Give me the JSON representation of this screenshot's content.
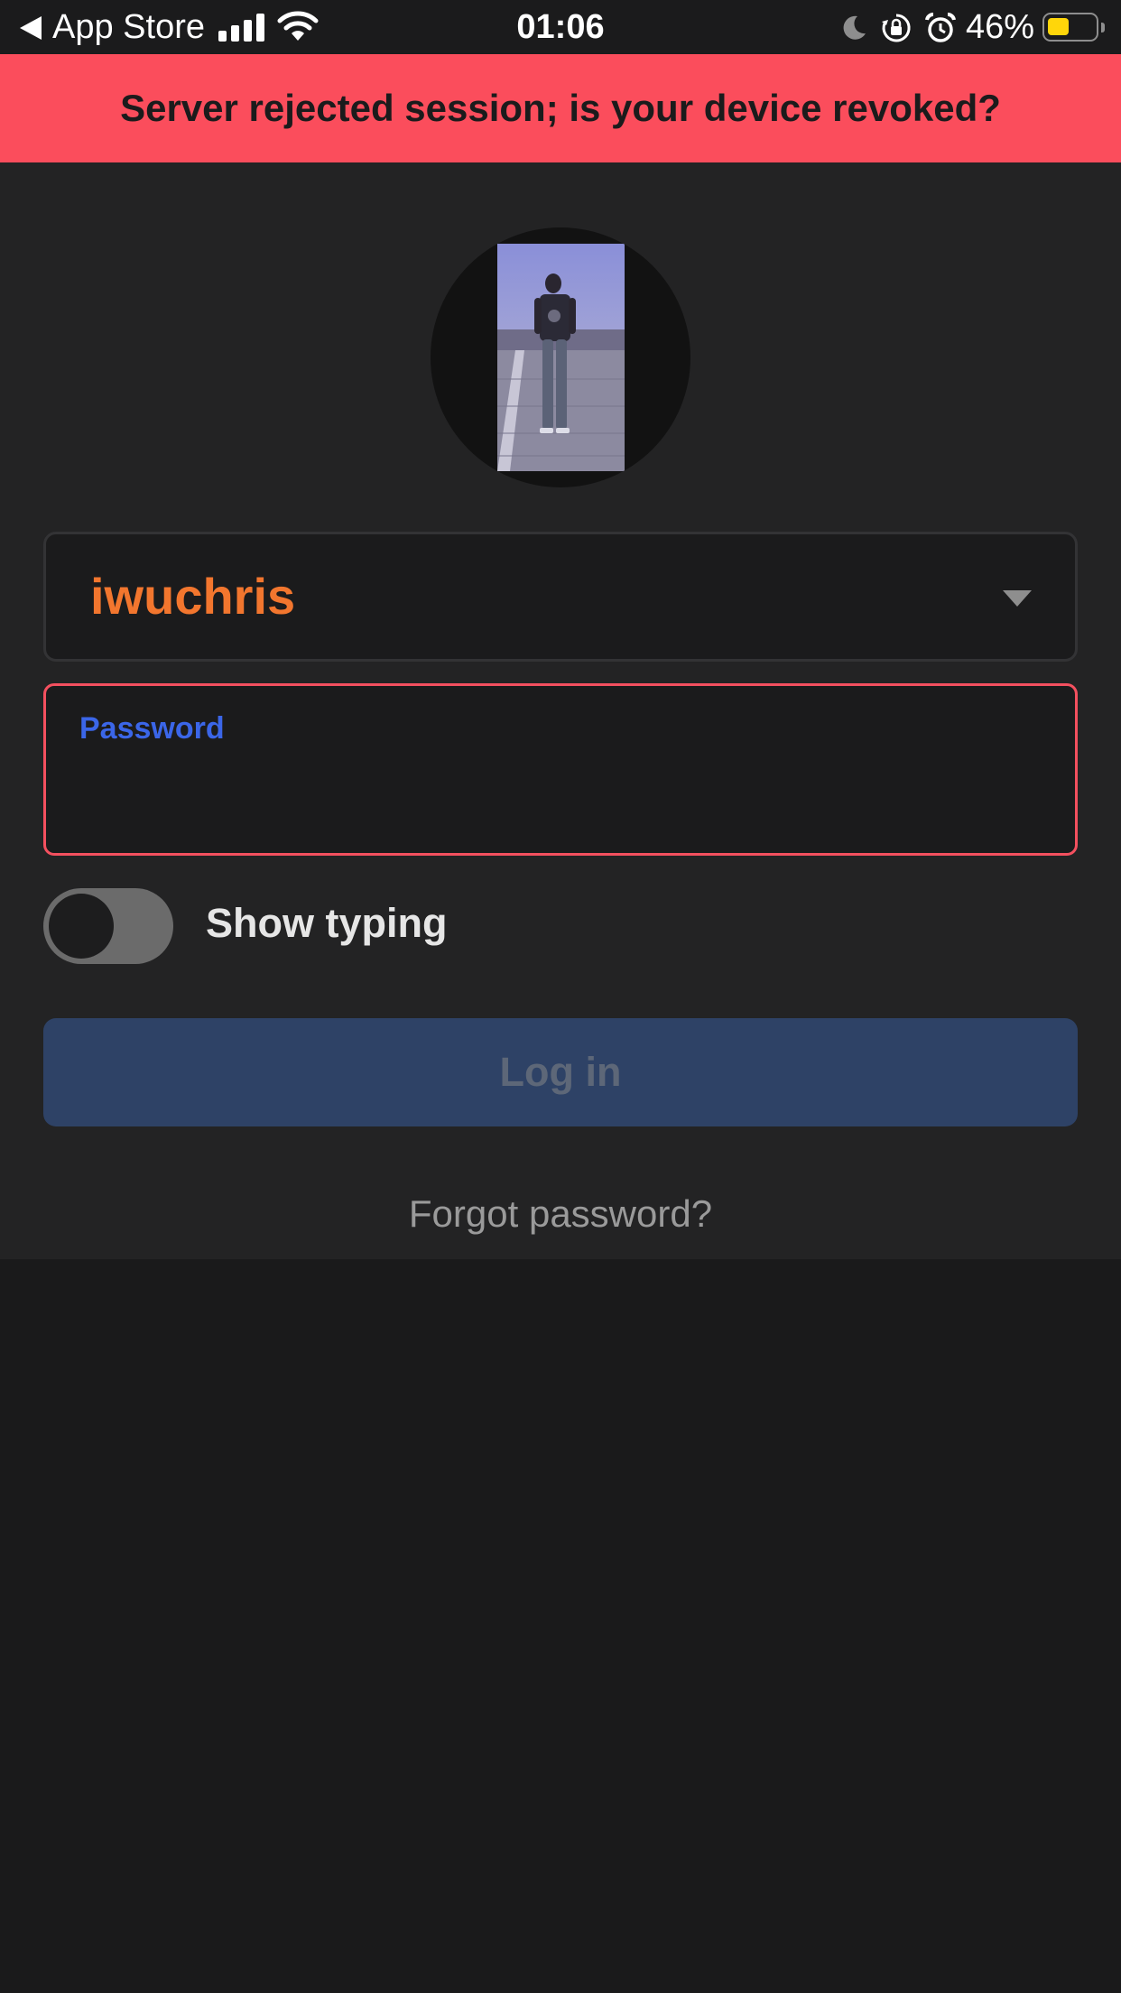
{
  "status_bar": {
    "back_app": "App Store",
    "time": "01:06",
    "battery_percent": "46%",
    "battery_level": 0.46,
    "icons": [
      "back-arrow-icon",
      "signal-bars-icon",
      "wifi-icon",
      "moon-icon",
      "orientation-lock-icon",
      "alarm-icon",
      "battery-icon"
    ]
  },
  "banner": {
    "message": "Server rejected session; is your device revoked?",
    "color": "#fb4d5c"
  },
  "login": {
    "username": "iwuchris",
    "username_color": "#f2762e",
    "password_label": "Password",
    "password_value": "",
    "show_typing_label": "Show typing",
    "show_typing_on": false,
    "login_button": "Log in",
    "forgot_password": "Forgot password?"
  },
  "colors": {
    "error": "#f4505f",
    "accent": "#3b66e8",
    "button": "#2e4266"
  }
}
